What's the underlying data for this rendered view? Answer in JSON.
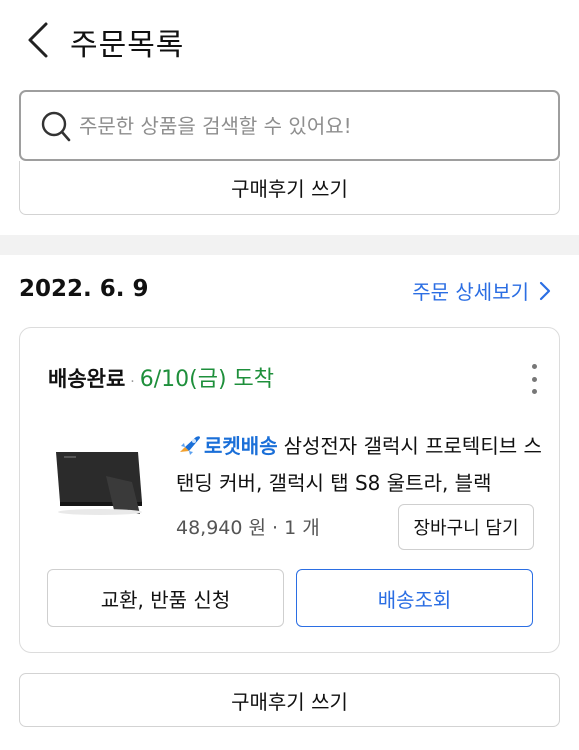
{
  "header": {
    "title": "주문목록",
    "back_icon": "chevron-left-icon"
  },
  "search": {
    "placeholder": "주문한 상품을 검색할 수 있어요!",
    "value": "",
    "icon": "search-icon"
  },
  "review_button_label": "구매후기 쓰기",
  "order": {
    "date": "2022. 6. 9",
    "detail_link_label": "주문 상세보기",
    "status": "배송완료",
    "separator": "·",
    "arrival": "6/10(금) 도착",
    "more_icon": "more-vertical-icon",
    "product": {
      "badge": "로켓배송",
      "badge_icon": "rocket-icon",
      "name": "삼성전자 갤럭시 프로텍티브 스탠딩 커버, 갤럭시 탭 S8 울트라, 블랙",
      "price_qty": "48,940 원 · 1 개",
      "cart_button_label": "장바구니 담기"
    },
    "exchange_button_label": "교환, 반품 신청",
    "track_button_label": "배송조회"
  },
  "colors": {
    "accent_blue": "#2b6ee3",
    "arrival_green": "#1e8f3b",
    "rocket_blue": "#1a6fd8"
  }
}
